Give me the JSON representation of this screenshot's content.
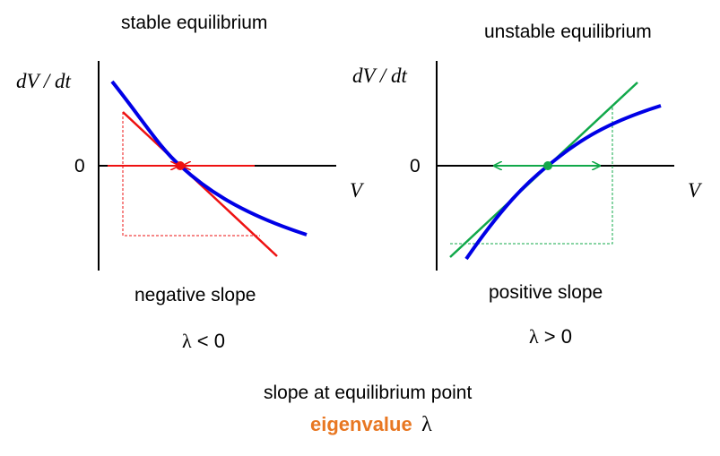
{
  "panels": {
    "left": {
      "title": "stable equilibrium",
      "y_label": "dV / dt",
      "zero_label": "0",
      "x_label": "V",
      "slope_label": "negative slope",
      "condition_symbol": "λ",
      "condition_text": " < 0"
    },
    "right": {
      "title": "unstable equilibrium",
      "y_label": "dV / dt",
      "zero_label": "0",
      "x_label": "V",
      "slope_label": "positive slope",
      "condition_symbol": "λ",
      "condition_text": " > 0"
    }
  },
  "footer": {
    "line1": "slope at equilibrium point",
    "eigen_word": "eigenvalue",
    "eigen_symbol": "λ"
  },
  "colors": {
    "curve": "#0000e6",
    "stable_tangent": "#ee1111",
    "unstable_tangent": "#11a84a",
    "axis": "#000000",
    "eigen_word": "#e87722"
  }
}
